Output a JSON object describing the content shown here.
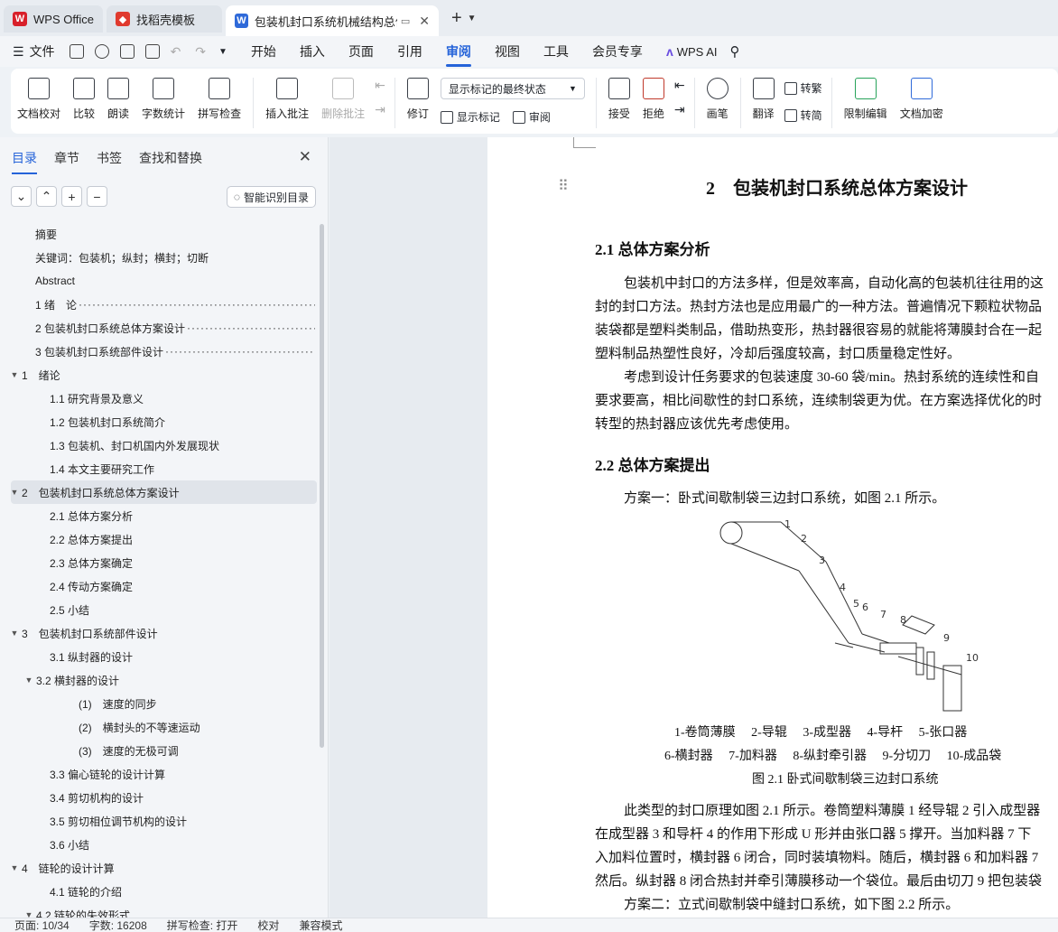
{
  "tabs": [
    {
      "label": "WPS Office",
      "color": "#d8202a"
    },
    {
      "label": "找稻壳模板",
      "color": "#e03a2e"
    },
    {
      "label": "包装机封口系统机械结构总体",
      "color": "#2f6ad9"
    }
  ],
  "menu": {
    "file": "文件",
    "items": [
      "开始",
      "插入",
      "页面",
      "引用",
      "审阅",
      "视图",
      "工具",
      "会员专享"
    ],
    "active": "审阅",
    "ai": "WPS AI"
  },
  "ribbon": {
    "doc_proof": "文档校对",
    "compare": "比较",
    "read": "朗读",
    "wordcount": "字数统计",
    "spell": "拼写检查",
    "insert_comment": "插入批注",
    "delete_comment": "删除批注",
    "revise": "修订",
    "markup_state": "显示标记的最终状态",
    "show_markup": "显示标记",
    "review": "审阅",
    "accept": "接受",
    "reject": "拒绝",
    "pen": "画笔",
    "translate": "翻译",
    "to_trad": "转繁",
    "to_simp": "转简",
    "restrict": "限制编辑",
    "encrypt": "文档加密"
  },
  "nav": {
    "tabs": [
      "目录",
      "章节",
      "书签",
      "查找和替换"
    ],
    "smart": "智能识别目录",
    "items": [
      {
        "label": "摘要",
        "level": 0
      },
      {
        "label": "关键词：包装机；纵封；横封；切断",
        "level": 0
      },
      {
        "label": "Abstract",
        "level": 0
      },
      {
        "label": "1 绪　论",
        "level": 0,
        "dots": true
      },
      {
        "label": "2 包装机封口系统总体方案设计",
        "level": 0,
        "dots": true
      },
      {
        "label": "3 包装机封口系统部件设计",
        "level": 0,
        "dots": true
      },
      {
        "label": "1　绪论",
        "level": 0,
        "arrow": true
      },
      {
        "label": "1.1 研究背景及意义",
        "level": 1
      },
      {
        "label": "1.2 包装机封口系统简介",
        "level": 1
      },
      {
        "label": "1.3 包装机、封口机国内外发展现状",
        "level": 1
      },
      {
        "label": "1.4 本文主要研究工作",
        "level": 1
      },
      {
        "label": "2　包装机封口系统总体方案设计",
        "level": 0,
        "arrow": true,
        "sel": true
      },
      {
        "label": "2.1 总体方案分析",
        "level": 1
      },
      {
        "label": "2.2 总体方案提出",
        "level": 1
      },
      {
        "label": "2.3 总体方案确定",
        "level": 1
      },
      {
        "label": "2.4 传动方案确定",
        "level": 1
      },
      {
        "label": "2.5 小结",
        "level": 1
      },
      {
        "label": "3　包装机封口系统部件设计",
        "level": 0,
        "arrow": true
      },
      {
        "label": "3.1 纵封器的设计",
        "level": 1
      },
      {
        "label": "3.2 横封器的设计",
        "level": 1,
        "arrow": true
      },
      {
        "label": "(1)　速度的同步",
        "level": 2
      },
      {
        "label": "(2)　横封头的不等速运动",
        "level": 2
      },
      {
        "label": "(3)　速度的无极可调",
        "level": 2
      },
      {
        "label": "3.3 偏心链轮的设计计算",
        "level": 1
      },
      {
        "label": "3.4 剪切机构的设计",
        "level": 1
      },
      {
        "label": "3.5  剪切相位调节机构的设计",
        "level": 1
      },
      {
        "label": "3.6 小结",
        "level": 1
      },
      {
        "label": "4　链轮的设计计算",
        "level": 0,
        "arrow": true
      },
      {
        "label": "4.1 链轮的介绍",
        "level": 1
      },
      {
        "label": "4.2 链轮的失效形式",
        "level": 1,
        "arrow": true
      }
    ]
  },
  "doc": {
    "chapter_title": "2　包装机封口系统总体方案设计",
    "h21": "2.1 总体方案分析",
    "p1": [
      "包装机中封口的方法多样，但是效率高，自动化高的包装机往往用的这",
      "封的封口方法。热封方法也是应用最广的一种方法。普遍情况下颗粒状物品",
      "装袋都是塑料类制品，借助热变形，热封器很容易的就能将薄膜封合在一起",
      "塑料制品热塑性良好，冷却后强度较高，封口质量稳定性好。"
    ],
    "p2": [
      "考虑到设计任务要求的包装速度 30-60 袋/min。热封系统的连续性和自",
      "要求要高，相比间歇性的封口系统，连续制袋更为优。在方案选择优化的时",
      "转型的热封器应该优先考虑使用。"
    ],
    "h22": "2.2 总体方案提出",
    "p3": "方案一：卧式间歇制袋三边封口系统，如图 2.1 所示。",
    "legend1": "1-卷筒薄膜　 2-导辊　 3-成型器　 4-导杆　 5-张口器",
    "legend2": "6-横封器　 7-加料器　 8-纵封牵引器　 9-分切刀　 10-成品袋",
    "caption": "图 2.1 卧式间歇制袋三边封口系统",
    "p4": [
      "此类型的封口原理如图 2.1 所示。卷筒塑料薄膜 1 经导辊 2 引入成型器",
      "在成型器 3 和导杆 4 的作用下形成 U 形并由张口器 5 撑开。当加料器 7 下",
      "入加料位置时，横封器 6 闭合，同时装填物料。随后，横封器 6 和加料器 7",
      "然后。纵封器 8 闭合热封并牵引薄膜移动一个袋位。最后由切刀 9 把包装袋"
    ],
    "p5": "方案二：立式间歇制袋中缝封口系统，如下图 2.2 所示。"
  },
  "status": {
    "page": "页面: 10/34",
    "words": "字数: 16208",
    "spell": "拼写检查: 打开",
    "proof": "校对",
    "compat": "兼容模式"
  }
}
